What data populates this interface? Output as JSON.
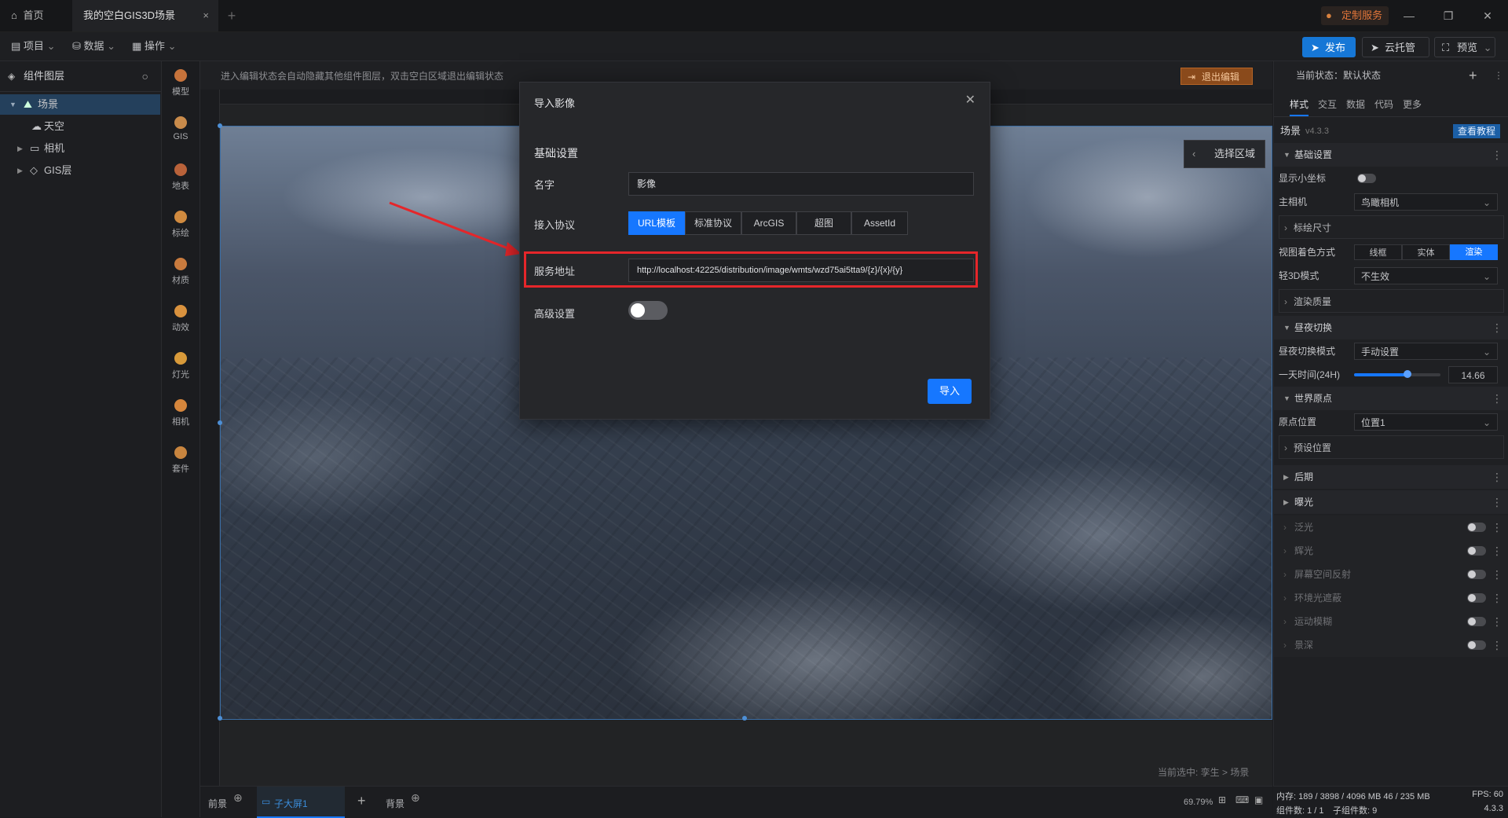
{
  "titlebar": {
    "home_tab": "首页",
    "scene_tab": "我的空白GIS3D场景",
    "close_glyph": "×",
    "new_tab_glyph": "+",
    "custom_service": "定制服务",
    "min_glyph": "—",
    "restore_glyph": "❐",
    "close_win_glyph": "✕"
  },
  "menubar": {
    "project": "项目",
    "data": "数据",
    "operate": "操作",
    "publish": "发布",
    "cloud_host": "云托管",
    "preview": "预览"
  },
  "left_panel": {
    "title": "组件图层",
    "tree": [
      {
        "label": "场景",
        "selected": true
      },
      {
        "label": "天空"
      },
      {
        "label": "相机"
      },
      {
        "label": "GIS层"
      }
    ]
  },
  "rail": {
    "items": [
      {
        "label": "模型",
        "color": "#c7733b"
      },
      {
        "label": "GIS",
        "color": "#c98b4b"
      },
      {
        "label": "地表",
        "color": "#b9623a"
      },
      {
        "label": "标绘",
        "color": "#d08a3f"
      },
      {
        "label": "材质",
        "color": "#c97b3e"
      },
      {
        "label": "动效",
        "color": "#d9923e"
      },
      {
        "label": "灯光",
        "color": "#d89a3a"
      },
      {
        "label": "相机",
        "color": "#d6863c"
      },
      {
        "label": "套件",
        "color": "#c8853f"
      }
    ]
  },
  "canvas": {
    "edit_hint": "进入编辑状态会自动隐藏其他组件图层，双击空白区域退出编辑状态",
    "exit_edit": "退出编辑",
    "select_area": "选择区域",
    "current_selection": "当前选中: 孪生 > 场景"
  },
  "bottom_tabs": {
    "foreground": "前景",
    "sub_screen": "子大屏1",
    "background": "背景",
    "zoom": "69.79%"
  },
  "right_panel": {
    "current_state": "当前状态：默认状态",
    "tabs": [
      "样式",
      "交互",
      "数据",
      "代码",
      "更多"
    ],
    "scene_title": "场景",
    "version": "v4.3.3",
    "tutorial_btn": "查看教程",
    "basic_settings": "基础设置",
    "show_axis": "显示小坐标",
    "main_camera": "主相机",
    "main_camera_value": "鸟瞰相机",
    "plot_size": "标绘尺寸",
    "view_color_mode": "视图着色方式",
    "color_modes": [
      "线框",
      "实体",
      "渲染"
    ],
    "light3d_mode": "轻3D模式",
    "light3d_value": "不生效",
    "render_quality": "渲染质量",
    "day_night": "昼夜切换",
    "day_night_mode": "昼夜切换模式",
    "day_night_mode_value": "手动设置",
    "day_time": "一天时间(24H)",
    "day_time_value": "14.66",
    "world_origin": "世界原点",
    "origin_position": "原点位置",
    "origin_position_value": "位置1",
    "preset_position": "预设位置",
    "post": "后期",
    "exposure": "曝光",
    "bloom": "泛光",
    "halo": "辉光",
    "ssr": "屏幕空间反射",
    "ao": "环境光遮蔽",
    "motion_blur": "运动模糊",
    "dof": "景深"
  },
  "status": {
    "memory": "内存: 189 / 3898 / 4096 MB 46 / 235 MB",
    "fps": "FPS: 60",
    "components": "组件数: 1 / 1",
    "sub_components": "子组件数: 9",
    "version": "4.3.3"
  },
  "modal": {
    "title": "导入影像",
    "section": "基础设置",
    "name_label": "名字",
    "name_value": "影像",
    "protocol_label": "接入协议",
    "protocols": [
      "URL模板",
      "标准协议",
      "ArcGIS",
      "超图",
      "AssetId"
    ],
    "active_protocol_index": 0,
    "url_label": "服务地址",
    "url_value": "http://localhost:42225/distribution/image/wmts/wzd75ai5tta9/{z}/{x}/{y}",
    "advanced_label": "高级设置",
    "import_btn": "导入"
  },
  "colors": {
    "accent": "#1677ff",
    "highlight": "#e5262a"
  }
}
